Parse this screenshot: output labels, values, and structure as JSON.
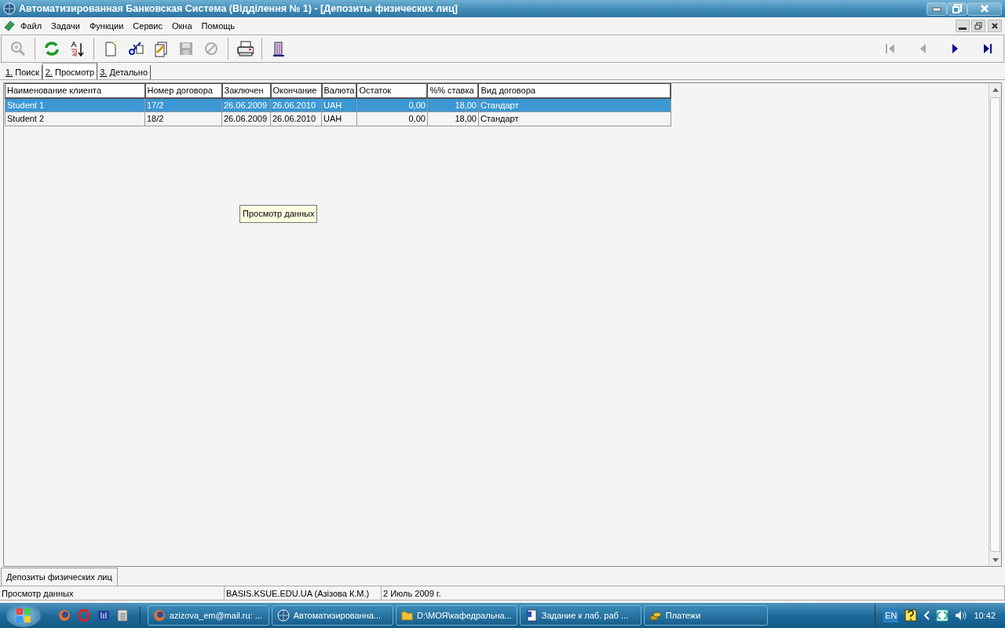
{
  "window": {
    "title": "Автоматизированная Банковская Система (Відділення № 1) - [Депозиты физических лиц]"
  },
  "menu": {
    "items": [
      "Файл",
      "Задачи",
      "Функции",
      "Сервис",
      "Окна",
      "Помощь"
    ]
  },
  "toolbar": {
    "buttons": [
      {
        "kind": "zoom",
        "disabled": true
      },
      {
        "kind": "refresh",
        "disabled": false
      },
      {
        "kind": "sort",
        "disabled": false
      },
      {
        "kind": "new",
        "disabled": false
      },
      {
        "kind": "cut",
        "disabled": false
      },
      {
        "kind": "edit",
        "disabled": false
      },
      {
        "kind": "save",
        "disabled": true
      },
      {
        "kind": "cancel",
        "disabled": true
      },
      {
        "kind": "print",
        "disabled": false
      },
      {
        "kind": "exit",
        "disabled": false
      }
    ],
    "navigation": [
      {
        "kind": "first",
        "disabled": true
      },
      {
        "kind": "prev",
        "disabled": true
      },
      {
        "kind": "next",
        "disabled": false
      },
      {
        "kind": "last",
        "disabled": false
      }
    ]
  },
  "tabs": [
    {
      "label": "1. Поиск",
      "selected": false
    },
    {
      "label": "2. Просмотр",
      "selected": true
    },
    {
      "label": "3. Детально",
      "selected": false
    }
  ],
  "table": {
    "columns": [
      "Наименование клиента",
      "Номер договора",
      "Заключен",
      "Окончание",
      "Валюта",
      "Остаток",
      "%% ставка",
      "Вид договора"
    ],
    "rows": [
      {
        "cells": [
          "Student 1",
          "17/2",
          "26.06.2009",
          "26.06.2010",
          "UAH",
          "0,00",
          "18,00",
          "Стандарт"
        ],
        "selected": true
      },
      {
        "cells": [
          "Student 2",
          "18/2",
          "26.06.2009",
          "26.06.2010",
          "UAH",
          "0,00",
          "18,00",
          "Стандарт"
        ],
        "selected": false
      }
    ]
  },
  "tooltip": "Просмотр данных",
  "document_tabs": [
    {
      "label": "Депозиты физических лиц",
      "selected": true
    }
  ],
  "status_bar": [
    "Просмотр данных",
    "BASIS.KSUE.EDU.UA (Азізова К.М.)",
    "2 Июль 2009 г."
  ],
  "taskbar": {
    "quick_launch": [
      {
        "kind": "firefox"
      },
      {
        "kind": "opera"
      },
      {
        "kind": "media"
      },
      {
        "kind": "calculator"
      }
    ],
    "buttons": [
      {
        "label": "azizova_em@mail.ru: ...",
        "kind": "firefox"
      },
      {
        "label": "Автоматизированна...",
        "kind": "globe"
      },
      {
        "label": "D:\\МОЯ\\кафедральна...",
        "kind": "folder"
      },
      {
        "label": "Задание к лаб. раб ...",
        "kind": "word"
      },
      {
        "label": "Платежи",
        "kind": "coins"
      }
    ],
    "language": "EN",
    "clock": "10:42"
  }
}
